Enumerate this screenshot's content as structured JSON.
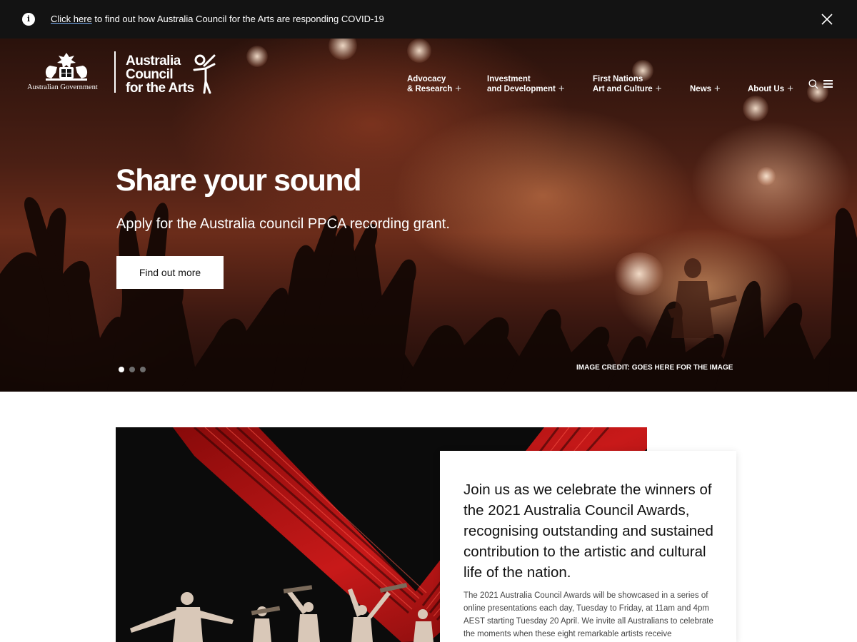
{
  "alert": {
    "link_text": "Click here",
    "message": " to find out how Australia Council for the Arts are responding COVID-19",
    "info_icon": "info-icon",
    "close_icon": "close-icon"
  },
  "logo": {
    "government_text": "Australian Government",
    "council_lines": [
      "Australia",
      "Council",
      "for the Arts"
    ]
  },
  "nav": {
    "items": [
      {
        "line1": "Advocacy",
        "line2": "& Research"
      },
      {
        "line1": "Investment",
        "line2": "and Development"
      },
      {
        "line1": "First Nations",
        "line2": "Art and Culture"
      },
      {
        "line1": "",
        "line2": "News"
      },
      {
        "line1": "",
        "line2": "About Us"
      }
    ],
    "search_icon": "search-icon",
    "menu_icon": "hamburger-menu-icon"
  },
  "hero": {
    "title": "Share your sound",
    "subtitle": "Apply for the Australia council PPCA recording grant.",
    "button_label": "Find out more",
    "image_credit": "IMAGE CREDIT: GOES HERE FOR THE IMAGE",
    "slide_count": 3,
    "active_slide": 1
  },
  "feature": {
    "heading": "Join us as we celebrate the winners of the 2021 Australia Council Awards, recognising outstanding and sustained contribution to the artistic and cultural life of the nation.",
    "body": "The 2021 Australia Council Awards will be showcased in a series of online presentations each day, Tuesday to Friday, at 11am and 4pm AEST starting Tuesday 20 April. We invite all Australians to celebrate the moments when these eight remarkable artists receive"
  }
}
